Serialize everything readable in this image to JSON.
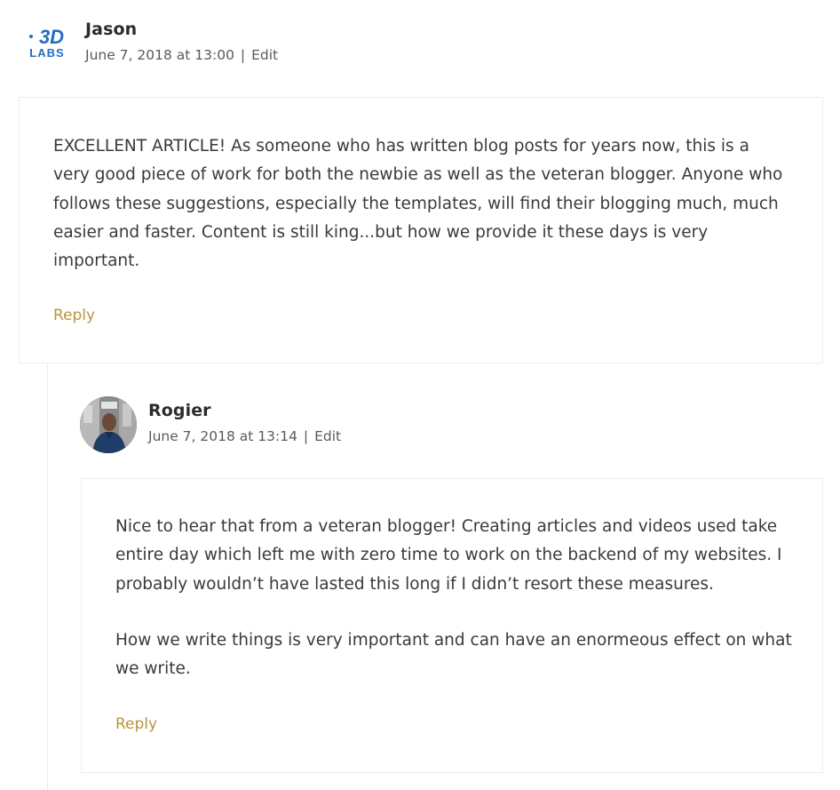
{
  "comments": [
    {
      "author": "Jason",
      "date": "June 7, 2018 at 13:00",
      "separator": "|",
      "edit_label": "Edit",
      "avatar_text_top": "3D",
      "avatar_text_bottom": "LABS",
      "paragraphs": [
        "EXCELLENT ARTICLE! As someone who has written blog posts for years now, this is a very good piece of work for both the newbie as well as the veteran blogger. Anyone who follows these suggestions, especially the templates, will find their blogging much, much easier and faster. Content is still king...but how we provide it these days is very important."
      ],
      "reply_label": "Reply"
    },
    {
      "author": "Rogier",
      "date": "June 7, 2018 at 13:14",
      "separator": "|",
      "edit_label": "Edit",
      "paragraphs": [
        "Nice to hear that from a veteran blogger! Creating articles and videos used take entire day which left me with zero time to work on the backend of my websites. I probably wouldn’t have lasted this long if I didn’t resort these measures.",
        "How we write things is very important and can have an enormeous effect on what we write."
      ],
      "reply_label": "Reply"
    }
  ],
  "colors": {
    "reply_link": "#b8963e",
    "avatar_logo_blue": "#1f6fbf",
    "border": "#ececec"
  }
}
